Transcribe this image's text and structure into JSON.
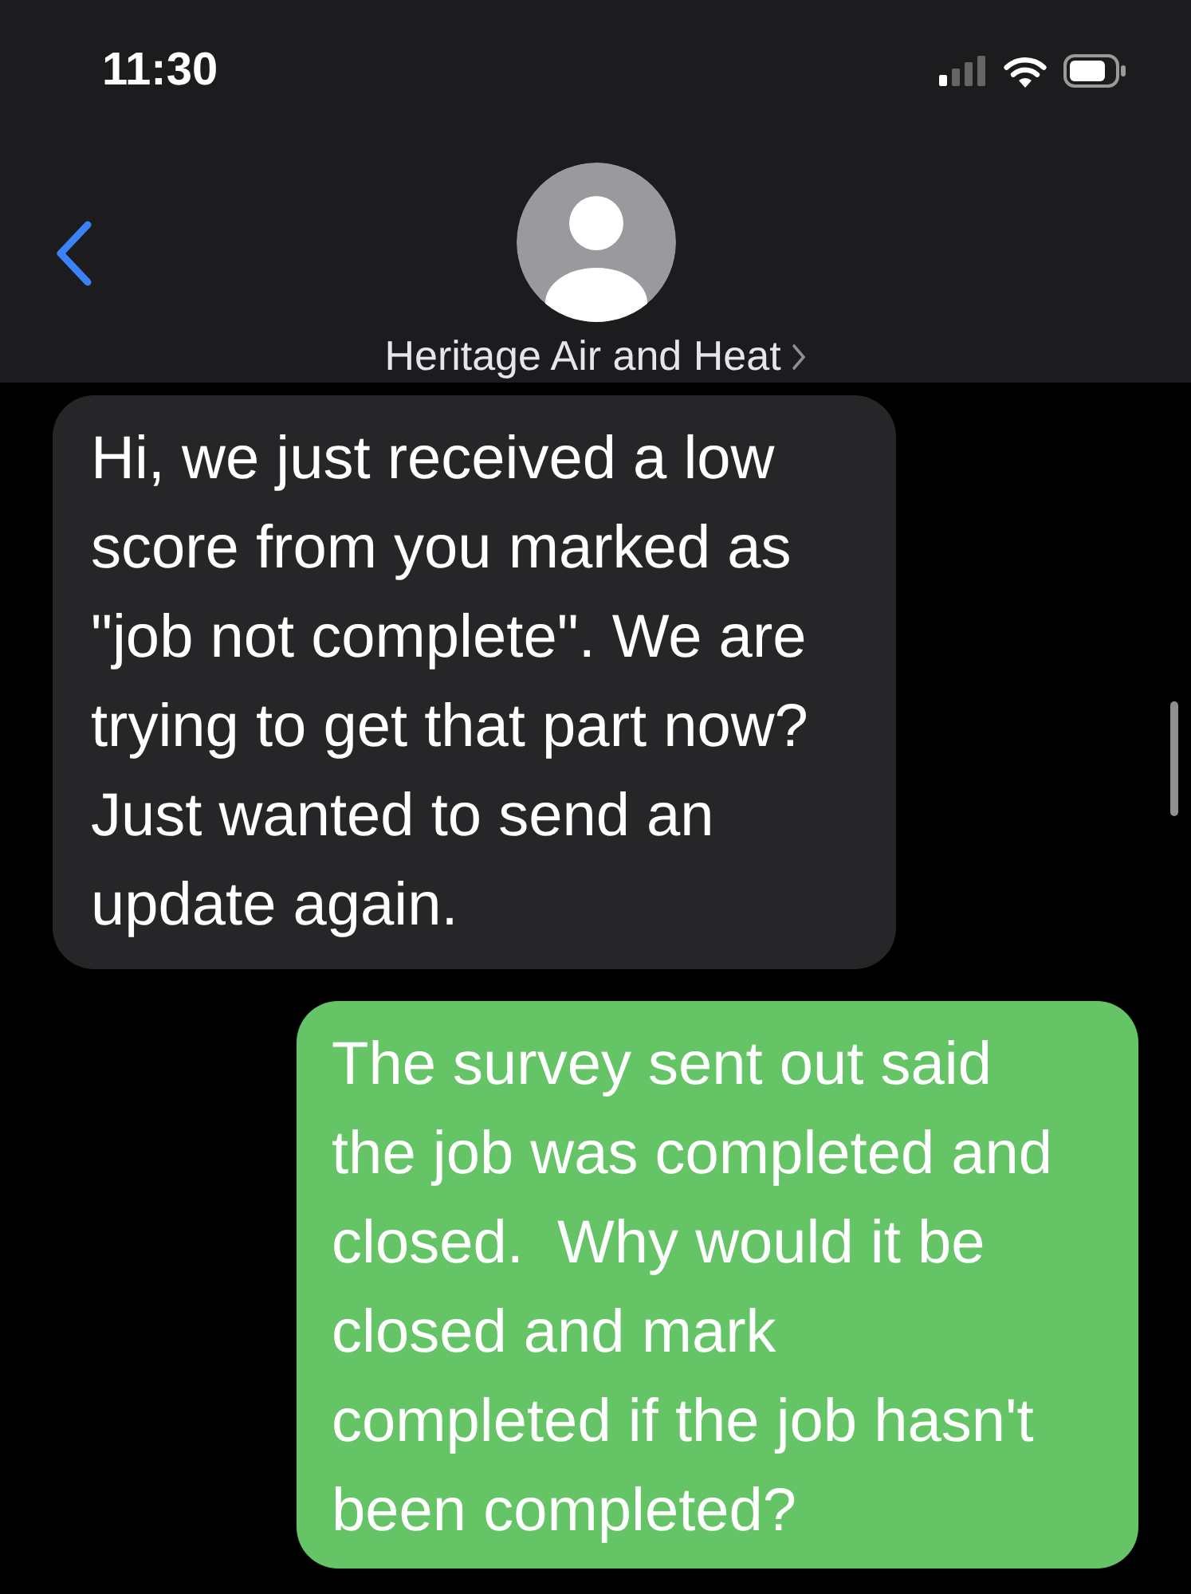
{
  "status_bar": {
    "time": "11:30"
  },
  "header": {
    "contact_name": "Heritage Air and Heat"
  },
  "messages": [
    {
      "kind": "incoming",
      "text": "Hi, we just received a low score from you marked as \"job not complete\". We are trying to get that part now? Just wanted to send an update again."
    },
    {
      "kind": "outgoing",
      "text": "The survey sent out said the job was completed and closed.  Why would it be closed and mark completed if the job hasn't been completed?"
    }
  ]
}
